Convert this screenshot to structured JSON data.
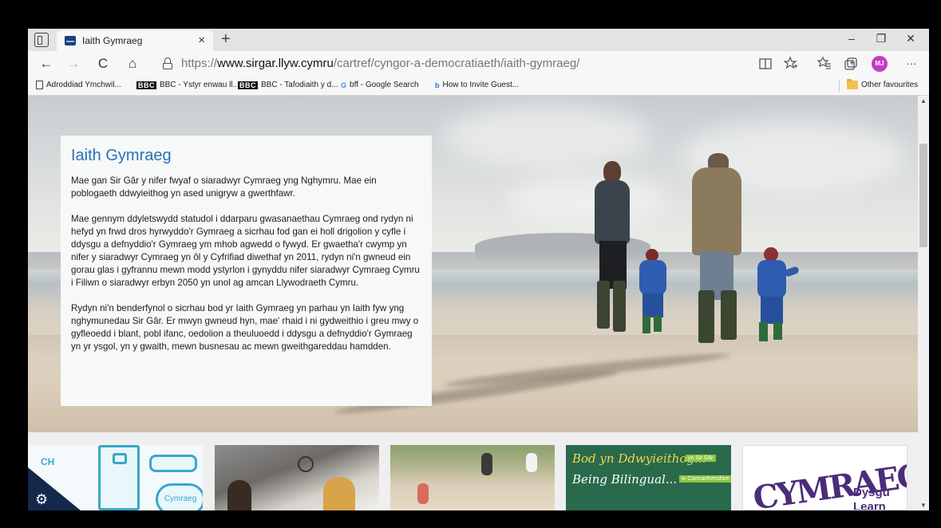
{
  "browser": {
    "tab_title": "Iaith Gymraeg",
    "tab_close": "×",
    "new_tab": "+",
    "window_controls": {
      "minimize": "–",
      "restore": "❐",
      "close": "✕"
    },
    "nav": {
      "back": "←",
      "forward": "→",
      "refresh": "C",
      "home": "⌂"
    },
    "url_prefix": "https://",
    "url_host": "www.sirgar.llyw.cymru",
    "url_path": "/cartref/cyngor-a-democratiaeth/iaith-gymraeg/",
    "toolbar_icons": [
      "reader-view-icon",
      "add-favourite-icon",
      "favourites-icon",
      "collections-icon"
    ],
    "profile_initials": "MJ",
    "more": "···",
    "favourites": [
      {
        "label": "Adroddiad Ymchwil...",
        "icon": "document-icon"
      },
      {
        "label": "BBC - Ystyr enwau ll...",
        "icon": "bbc-icon",
        "badge": "BBC"
      },
      {
        "label": "BBC - Tafodiaith y d...",
        "icon": "bbc-icon",
        "badge": "BBC"
      },
      {
        "label": "bff - Google Search",
        "icon": "google-icon",
        "badge": "G"
      },
      {
        "label": "How to Invite Guest...",
        "icon": "bing-icon",
        "badge": "b"
      }
    ],
    "other_favourites": "Other favourites"
  },
  "page": {
    "heading": "Iaith Gymraeg",
    "paragraphs": [
      "Mae gan Sir Gâr y nifer fwyaf o siaradwyr Cymraeg yng Nghymru. Mae ein poblogaeth ddwyieithog yn ased unigryw a gwerthfawr.",
      "Mae gennym ddyletswydd statudol i ddarparu gwasanaethau Cymraeg ond rydyn ni hefyd yn frwd dros hyrwyddo'r Gymraeg a sicrhau fod gan ei holl drigolion y cyfle i ddysgu a defnyddio'r Gymraeg ym mhob agwedd o fywyd. Er gwaetha'r cwymp yn nifer y siaradwyr Cymraeg yn ôl y Cyfrifiad diwethaf yn 2011, rydyn ni'n gwneud ein gorau glas i gyfrannu mewn modd ystyrlon i gynyddu nifer siaradwyr Cymraeg Cymru i Filiwn o siaradwyr erbyn 2050 yn unol ag amcan Llywodraeth Cymru.",
      "Rydyn ni'n benderfynol o sicrhau bod yr Iaith Gymraeg yn parhau yn Iaith fyw yng nghymunedau Sir Gâr. Er mwyn gwneud hyn, mae' rhaid i ni gydweithio i greu mwy o gyfleoedd i blant, pobl ifanc, oedolion a theuluoedd i ddysgu a defnyddio'r Gymraeg yn yr ysgol, yn y gwaith, mewn busnesau ac mewn gweithgareddau hamdden."
    ],
    "cards": {
      "card1_text": "CH",
      "card1_badge": "Cymraeg",
      "card4_line1": "Bod yn Ddwyieithog...",
      "card4_badge1": "yn Sir Gâr",
      "card4_line2": "Being Bilingual...",
      "card4_badge2": "in Carmarthenshire",
      "card5_logo": "CYMRAEG",
      "card5_dysgu": "Dysgu",
      "card5_learn": "Learn"
    }
  }
}
